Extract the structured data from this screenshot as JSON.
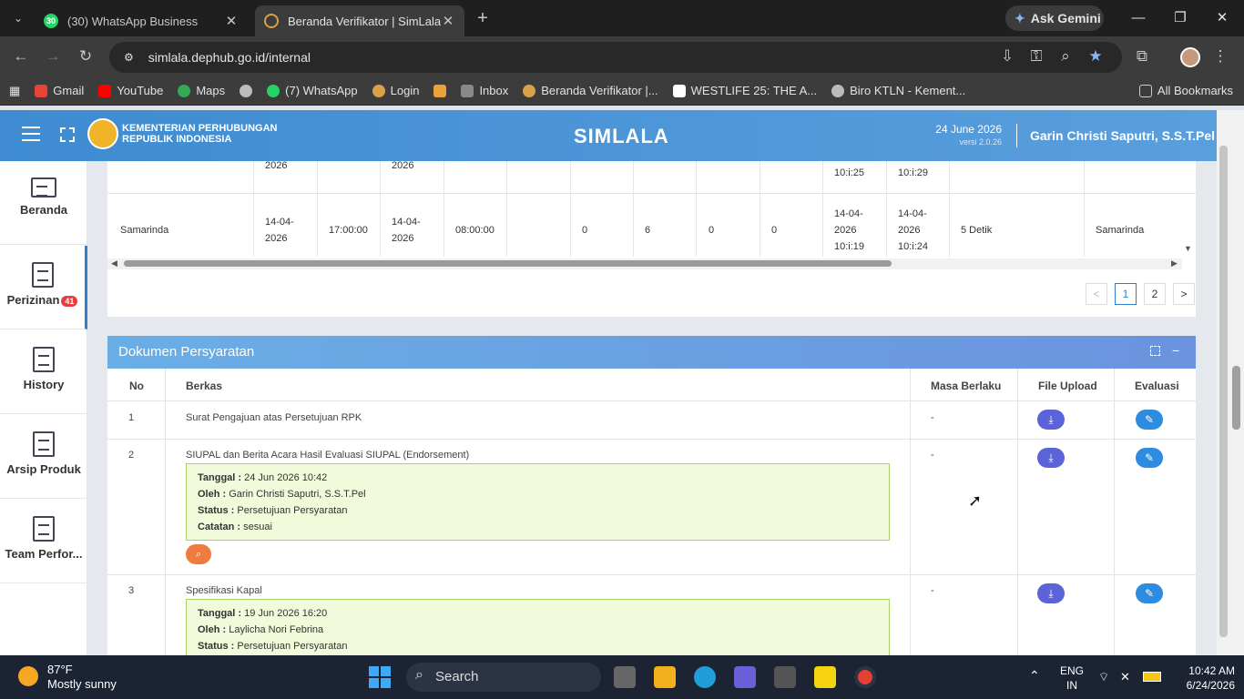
{
  "browser": {
    "tabs": [
      {
        "title": "(30) WhatsApp Business",
        "favicon_text": "30"
      },
      {
        "title": "Beranda Verifikator | SimLala"
      }
    ],
    "gemini_label": "Ask Gemini",
    "url": "simlala.dephub.go.id/internal",
    "bookmarks": [
      {
        "label": "Gmail",
        "color": "#ea4335"
      },
      {
        "label": "YouTube",
        "color": "#ff0000"
      },
      {
        "label": "Maps",
        "color": "#34a853"
      },
      {
        "label": "",
        "color": "#bbbbbb"
      },
      {
        "label": "(7) WhatsApp",
        "color": "#25d366"
      },
      {
        "label": "Login",
        "color": "#d9a24a"
      },
      {
        "label": "",
        "color": "#e9a23b"
      },
      {
        "label": "Inbox",
        "color": "#888888"
      },
      {
        "label": "Beranda Verifikator |...",
        "color": "#d9a24a"
      },
      {
        "label": "WESTLIFE 25: THE A...",
        "color": "#ffffff"
      },
      {
        "label": "Biro KTLN - Kement...",
        "color": "#bbbbbb"
      }
    ],
    "all_bookmarks": "All Bookmarks"
  },
  "header": {
    "org_line1": "KEMENTERIAN PERHUBUNGAN",
    "org_line2": "REPUBLIK INDONESIA",
    "brand": "SIMLALA",
    "date": "24 June 2026",
    "version": "versi 2.0.26",
    "user": "Garin Christi Saputri, S.S.T.Pel"
  },
  "sidebar": [
    {
      "label": "Beranda",
      "badge": ""
    },
    {
      "label": "Perizinan",
      "badge": "41"
    },
    {
      "label": "History",
      "badge": ""
    },
    {
      "label": "Arsip Produk",
      "badge": ""
    },
    {
      "label": "Team Perfor...",
      "badge": ""
    }
  ],
  "top_table": {
    "partial_row": {
      "c2": "2026",
      "c4": "2026",
      "c10": "10:i:25",
      "c11": "10:i:29"
    },
    "row": {
      "port": "Samarinda",
      "date1": "14-04-2026",
      "time1": "17:00:00",
      "date2": "14-04-2026",
      "time2": "08:00:00",
      "n1": "0",
      "n2": "6",
      "n3": "0",
      "n4": "0",
      "ts1": "14-04-2026 10:i:19",
      "ts2": "14-04-2026 10:i:24",
      "duration": "5 Detik",
      "dest": "Samarinda"
    },
    "pagination": {
      "prev": "<",
      "pages": [
        "1",
        "2"
      ],
      "next": ">"
    }
  },
  "documents_panel": {
    "title": "Dokumen Persyaratan",
    "columns": [
      "No",
      "Berkas",
      "Masa Berlaku",
      "File Upload",
      "Evaluasi"
    ],
    "rows": [
      {
        "no": "1",
        "berkas": "Surat Pengajuan atas Persetujuan RPK",
        "masa": "-"
      },
      {
        "no": "2",
        "berkas": "SIUPAL dan Berita Acara Hasil Evaluasi SIUPAL (Endorsement)",
        "masa": "-",
        "note": {
          "tanggal_label": "Tanggal :",
          "tanggal": "24 Jun 2026 10:42",
          "oleh_label": "Oleh :",
          "oleh": "Garin Christi Saputri, S.S.T.Pel",
          "status_label": "Status :",
          "status": "Persetujuan Persyaratan",
          "catatan_label": "Catatan :",
          "catatan": "sesuai"
        }
      },
      {
        "no": "3",
        "berkas": "Spesifikasi Kapal",
        "masa": "-",
        "note": {
          "tanggal_label": "Tanggal :",
          "tanggal": "19 Jun 2026 16:20",
          "oleh_label": "Oleh :",
          "oleh": "Laylicha Nori Febrina",
          "status_label": "Status :",
          "status": "Persetujuan Persyaratan"
        }
      }
    ]
  },
  "taskbar": {
    "temp": "87°F",
    "weather": "Mostly sunny",
    "search": "Search",
    "lang1": "ENG",
    "lang2": "IN",
    "time": "10:42 AM",
    "date": "6/24/2026"
  }
}
